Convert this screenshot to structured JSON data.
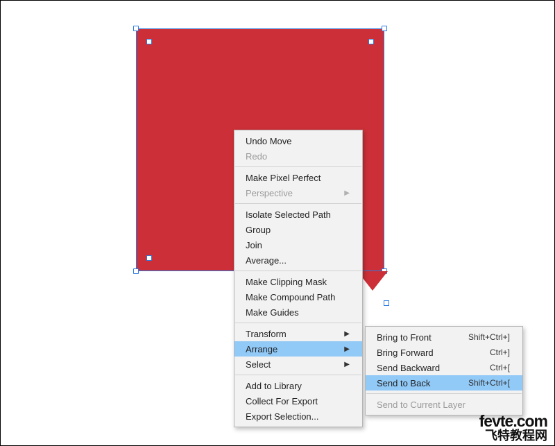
{
  "canvas": {
    "shape_color": "#cc2f37",
    "selection_color": "#2a7ae2"
  },
  "context_menu": {
    "undo": "Undo Move",
    "redo": "Redo",
    "pixel_perfect": "Make Pixel Perfect",
    "perspective": "Perspective",
    "isolate": "Isolate Selected Path",
    "group": "Group",
    "join": "Join",
    "average": "Average...",
    "clipping_mask": "Make Clipping Mask",
    "compound_path": "Make Compound Path",
    "make_guides": "Make Guides",
    "transform": "Transform",
    "arrange": "Arrange",
    "select": "Select",
    "add_library": "Add to Library",
    "collect_export": "Collect For Export",
    "export_selection": "Export Selection..."
  },
  "arrange_submenu": {
    "bring_front": {
      "label": "Bring to Front",
      "shortcut": "Shift+Ctrl+]"
    },
    "bring_forward": {
      "label": "Bring Forward",
      "shortcut": "Ctrl+]"
    },
    "send_backward": {
      "label": "Send Backward",
      "shortcut": "Ctrl+["
    },
    "send_back": {
      "label": "Send to Back",
      "shortcut": "Shift+Ctrl+["
    },
    "send_current_layer": {
      "label": "Send to Current Layer"
    }
  },
  "watermark": {
    "domain": "fevte.com",
    "zh": "飞特教程网"
  }
}
